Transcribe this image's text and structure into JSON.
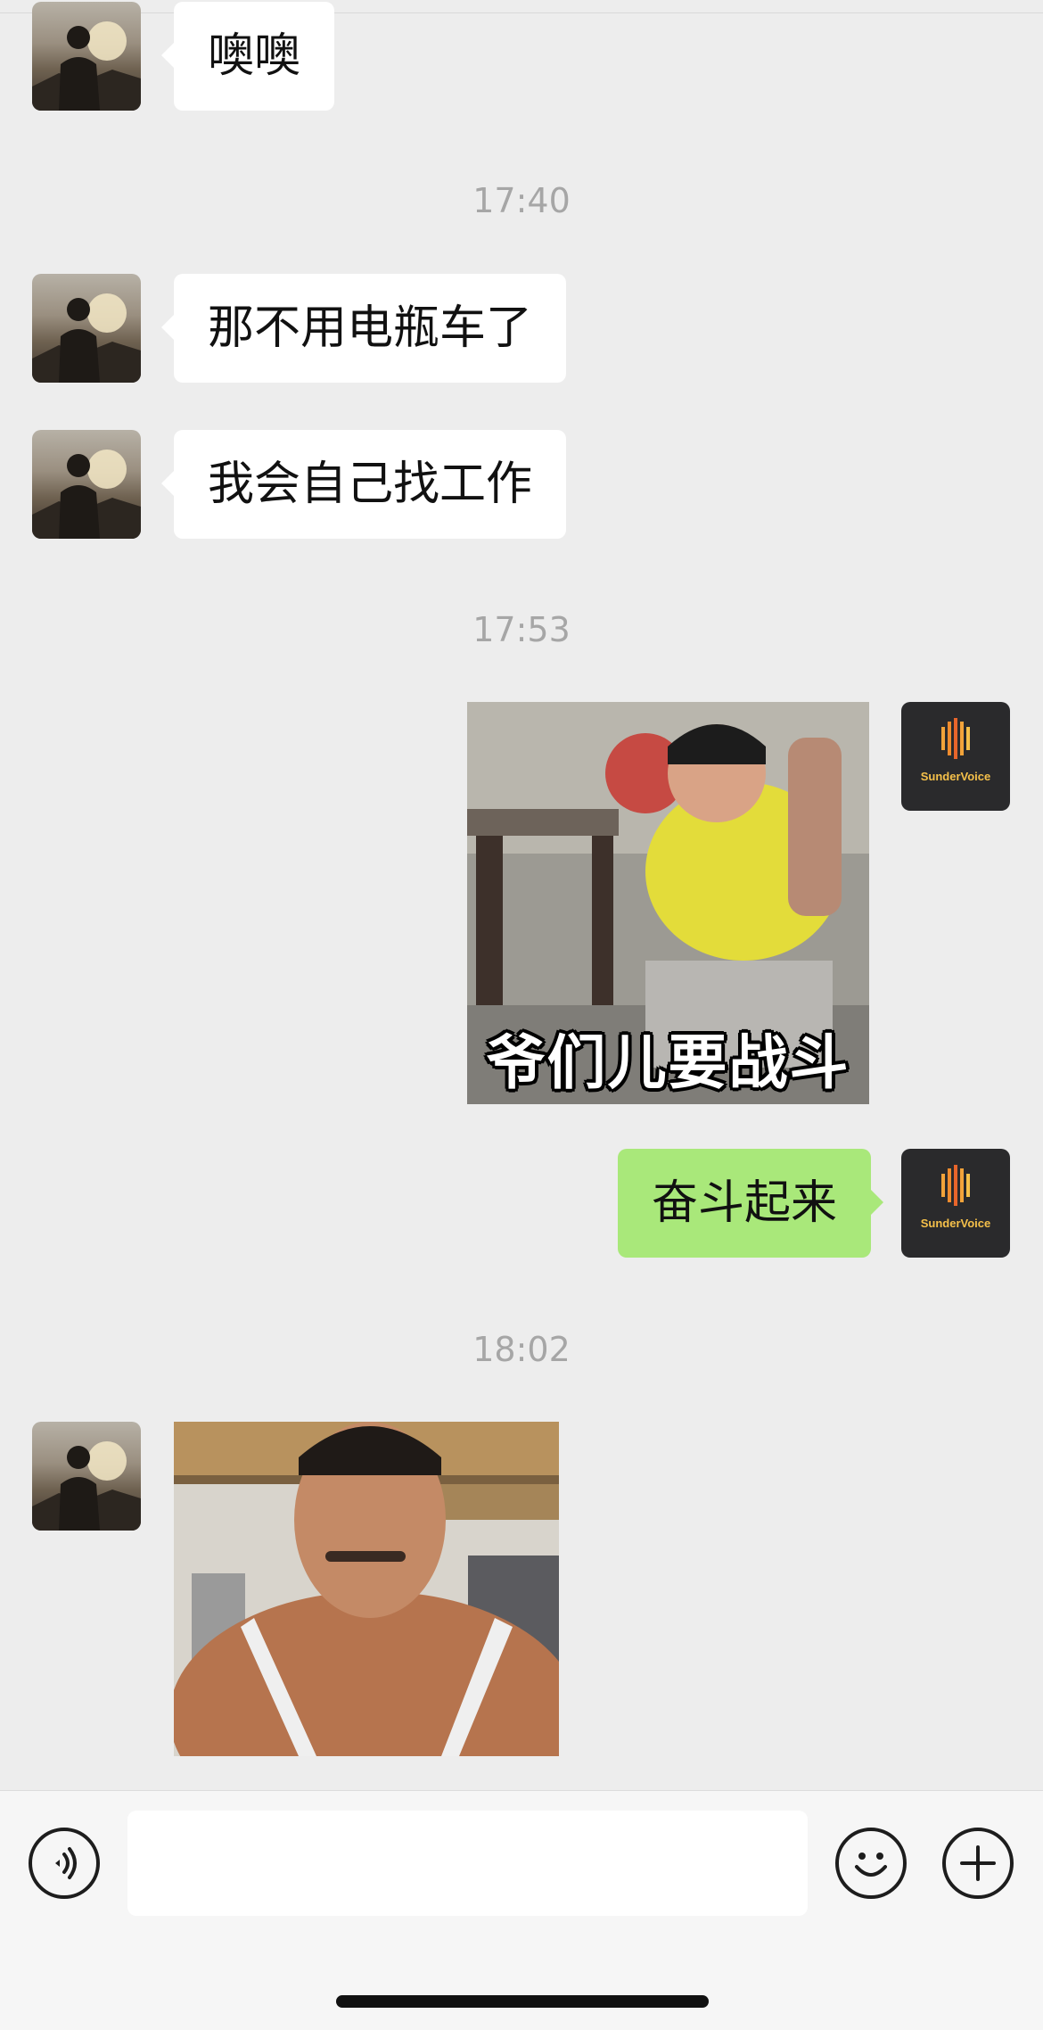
{
  "messages": [
    {
      "side": "left",
      "type": "text",
      "text": "噢噢"
    },
    {
      "type": "timestamp",
      "text": "17:40"
    },
    {
      "side": "left",
      "type": "text",
      "text": "那不用电瓶车了"
    },
    {
      "side": "left",
      "type": "text",
      "text": "我会自己找工作"
    },
    {
      "type": "timestamp",
      "text": "17:53"
    },
    {
      "side": "right",
      "type": "sticker",
      "caption": "爷们儿要战斗"
    },
    {
      "side": "right",
      "type": "text",
      "text": "奋斗起来"
    },
    {
      "type": "timestamp",
      "text": "18:02"
    },
    {
      "side": "left",
      "type": "sticker",
      "caption": ""
    }
  ],
  "my_avatar": {
    "label": "SunderVoice"
  },
  "input_bar": {
    "voice_icon": "voice-icon",
    "emoji_icon": "emoji-icon",
    "plus_icon": "plus-icon",
    "value": ""
  },
  "colors": {
    "background": "#ededed",
    "incoming_bubble": "#ffffff",
    "outgoing_bubble": "#a9e87a",
    "timestamp": "#a6a6a6"
  }
}
